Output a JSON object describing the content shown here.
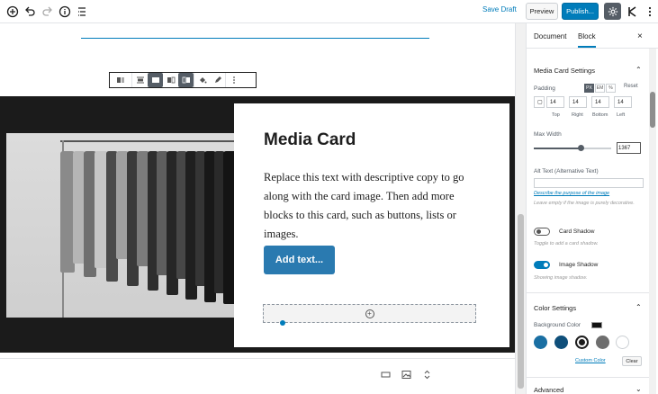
{
  "toolbar": {
    "save_draft": "Save Draft",
    "preview": "Preview",
    "publish": "Publish...",
    "icons": [
      "add-block-icon",
      "undo-icon",
      "redo-icon",
      "info-icon",
      "outline-icon",
      "gear-icon",
      "plugin-k-icon",
      "more-vertical-icon"
    ]
  },
  "card": {
    "title": "Media Card",
    "body": "Replace this text with descriptive copy to go along with the card image. Then add more blocks to this card, such as buttons, lists or images.",
    "button": "Add text..."
  },
  "sidebar": {
    "tabs": [
      "Document",
      "Block"
    ],
    "active_tab": "Block",
    "close": "×",
    "media_card_settings": "Media Card Settings",
    "padding": {
      "label": "Padding",
      "units": [
        "PX",
        "EM",
        "%"
      ],
      "active_unit": "PX",
      "reset": "Reset",
      "values": [
        "14",
        "14",
        "14",
        "14"
      ],
      "captions": [
        "Top",
        "Right",
        "Bottom",
        "Left"
      ]
    },
    "max_width": {
      "label": "Max Width",
      "value": "1367",
      "fraction": 0.6
    },
    "alt_text": {
      "label": "Alt Text (Alternative Text)",
      "link": "Describe the purpose of the image",
      "help": "Leave empty if the image is purely decorative."
    },
    "card_shadow": {
      "label": "Card Shadow",
      "help": "Toggle to add a card shadow.",
      "on": false
    },
    "image_shadow": {
      "label": "Image Shadow",
      "help": "Showing image shadow.",
      "on": true
    },
    "color_settings": {
      "title": "Color Settings",
      "bg_label": "Background Color",
      "swatches": [
        "#1a6fa3",
        "#0f4f7a",
        "#1b1b1b",
        "#6e6e6e",
        "#ffffff"
      ],
      "selected_index": 2,
      "custom_color": "Custom Color",
      "clear": "Clear"
    },
    "advanced": "Advanced"
  }
}
